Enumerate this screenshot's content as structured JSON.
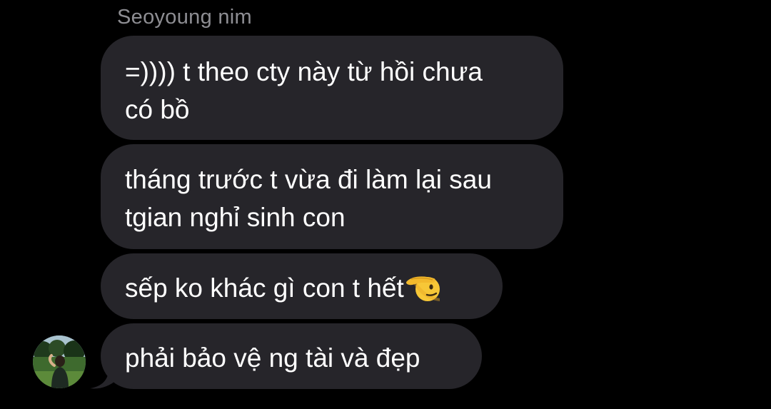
{
  "conversation": {
    "sender_name": "Seoyoung nim",
    "messages": [
      {
        "lines": [
          "=)))) t theo cty này từ hồi chưa",
          "có bồ"
        ]
      },
      {
        "lines": [
          "tháng trước t vừa đi làm lại sau",
          "tgian nghỉ sinh con"
        ]
      },
      {
        "lines": [
          "sếp ko khác gì con t hết"
        ],
        "emoji": "saluting-face-icon"
      },
      {
        "lines": [
          "phải bảo vệ ng tài và đẹp"
        ]
      }
    ]
  },
  "colors": {
    "background": "#000000",
    "bubble": "#26252a",
    "text": "#ffffff",
    "sender_name": "#8e8e93",
    "emoji_yellow": "#f7c737"
  }
}
